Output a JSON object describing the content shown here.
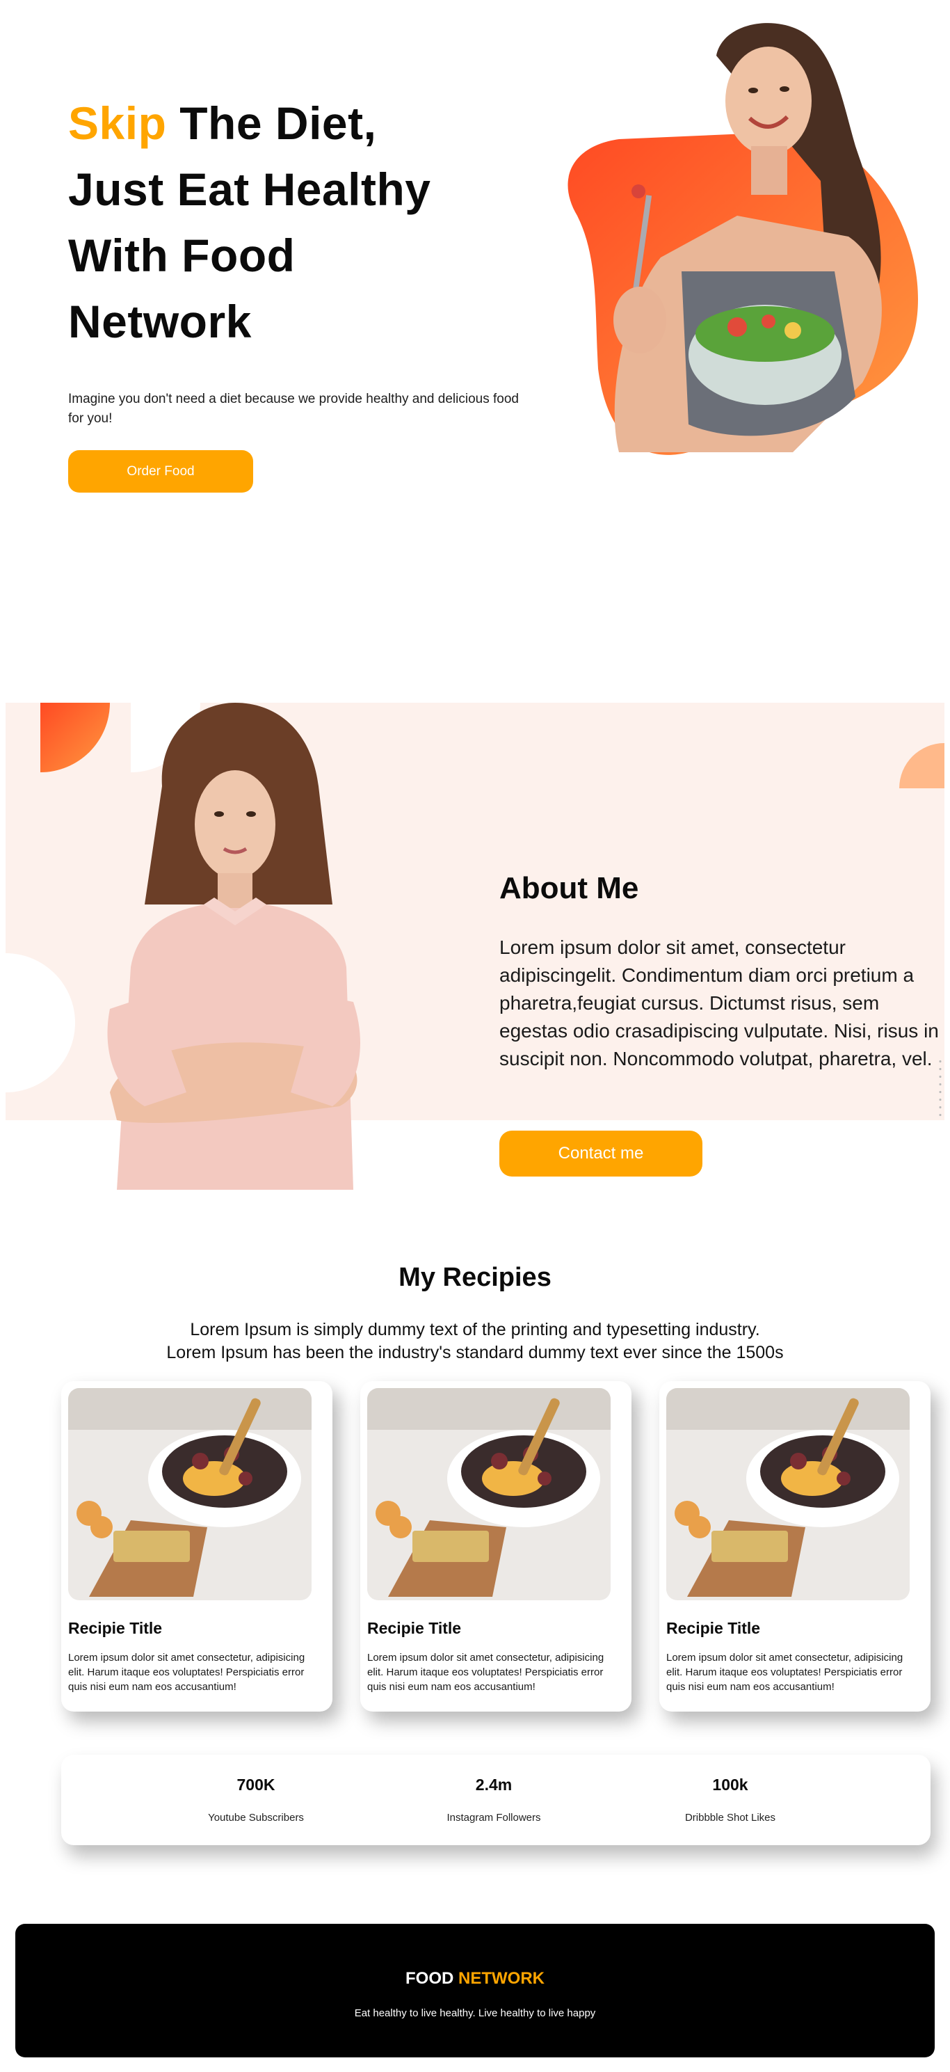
{
  "colors": {
    "accent": "#ffa500",
    "text": "#0b0b0b",
    "about_bg": "#fdf1ec",
    "footer_bg": "#000000"
  },
  "hero": {
    "title_accent": "Skip",
    "title_line1_rest": " The Diet,",
    "title_line2": "Just Eat Healthy",
    "title_line3": "With Food",
    "title_line4": "Network",
    "subtitle": "Imagine you don't need a diet because we provide healthy and delicious food for you!",
    "order_button": "Order Food"
  },
  "about": {
    "heading": "About Me",
    "text": "Lorem ipsum dolor sit amet, consectetur adipiscingelit. Condimentum diam orci pretium a pharetra,feugiat cursus. Dictumst risus, sem egestas odio crasadipiscing vulputate. Nisi, risus in suscipit non. Noncommodo volutpat, pharetra, vel.",
    "contact_button": "Contact me"
  },
  "recipes": {
    "title": "My Recipies",
    "intro_line1": "Lorem Ipsum is simply dummy text of the printing and typesetting industry.",
    "intro_line2": "Lorem Ipsum has been the industry's standard dummy text ever since the 1500s",
    "cards": [
      {
        "title": "Recipie Title",
        "text": "Lorem ipsum dolor sit amet consectetur, adipisicing elit. Harum itaque eos voluptates! Perspiciatis error quis nisi eum nam eos accusantium!"
      },
      {
        "title": "Recipie Title",
        "text": "Lorem ipsum dolor sit amet consectetur, adipisicing elit. Harum itaque eos voluptates! Perspiciatis error quis nisi eum nam eos accusantium!"
      },
      {
        "title": "Recipie Title",
        "text": "Lorem ipsum dolor sit amet consectetur, adipisicing elit. Harum itaque eos voluptates! Perspiciatis error quis nisi eum nam eos accusantium!"
      }
    ]
  },
  "stats": [
    {
      "value": "700K",
      "label": "Youtube Subscribers"
    },
    {
      "value": "2.4m",
      "label": "Instagram Followers"
    },
    {
      "value": "100k",
      "label": "Dribbble Shot Likes"
    }
  ],
  "footer": {
    "brand_main": "FOOD ",
    "brand_accent": "NETWORK",
    "tagline": "Eat healthy to live healthy. Live healthy to live happy"
  }
}
